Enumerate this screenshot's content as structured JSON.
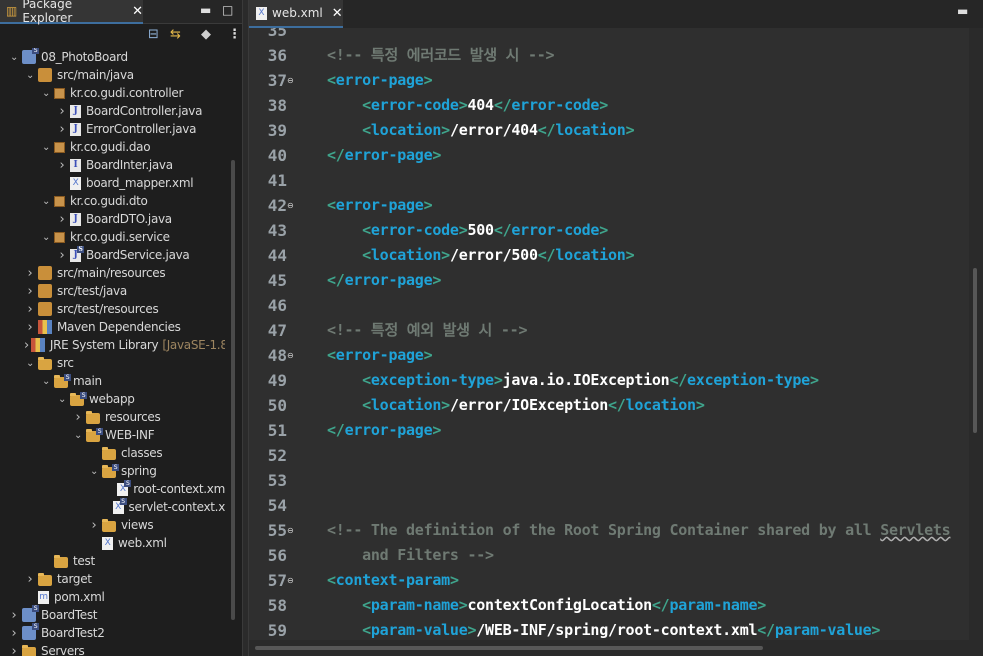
{
  "package_explorer": {
    "title": "Package Explorer",
    "tree": [
      {
        "label": "08_PhotoBoard",
        "level": 0,
        "expanded": true,
        "icon": "project-icon"
      },
      {
        "label": "src/main/java",
        "level": 1,
        "expanded": true,
        "icon": "source-folder-icon"
      },
      {
        "label": "kr.co.gudi.controller",
        "level": 2,
        "expanded": true,
        "icon": "package-icon"
      },
      {
        "label": "BoardController.java",
        "level": 3,
        "expanded": false,
        "icon": "java-file-icon"
      },
      {
        "label": "ErrorController.java",
        "level": 3,
        "expanded": false,
        "icon": "java-file-icon"
      },
      {
        "label": "kr.co.gudi.dao",
        "level": 2,
        "expanded": true,
        "icon": "package-icon"
      },
      {
        "label": "BoardInter.java",
        "level": 3,
        "expanded": false,
        "icon": "interface-file-icon"
      },
      {
        "label": "board_mapper.xml",
        "level": 3,
        "expanded": null,
        "icon": "xml-file-icon"
      },
      {
        "label": "kr.co.gudi.dto",
        "level": 2,
        "expanded": true,
        "icon": "package-icon"
      },
      {
        "label": "BoardDTO.java",
        "level": 3,
        "expanded": false,
        "icon": "java-file-icon"
      },
      {
        "label": "kr.co.gudi.service",
        "level": 2,
        "expanded": true,
        "icon": "package-icon"
      },
      {
        "label": "BoardService.java",
        "level": 3,
        "expanded": false,
        "icon": "spring-java-file-icon"
      },
      {
        "label": "src/main/resources",
        "level": 1,
        "expanded": false,
        "icon": "source-folder-icon"
      },
      {
        "label": "src/test/java",
        "level": 1,
        "expanded": false,
        "icon": "source-folder-icon"
      },
      {
        "label": "src/test/resources",
        "level": 1,
        "expanded": false,
        "icon": "source-folder-icon"
      },
      {
        "label": "Maven Dependencies",
        "level": 1,
        "expanded": false,
        "icon": "library-icon"
      },
      {
        "label": "JRE System Library",
        "suffix": "[JavaSE-1.8",
        "level": 1,
        "expanded": false,
        "icon": "library-icon"
      },
      {
        "label": "src",
        "level": 1,
        "expanded": true,
        "icon": "folder-icon"
      },
      {
        "label": "main",
        "level": 2,
        "expanded": true,
        "icon": "spring-folder-icon"
      },
      {
        "label": "webapp",
        "level": 3,
        "expanded": true,
        "icon": "spring-folder-icon"
      },
      {
        "label": "resources",
        "level": 4,
        "expanded": false,
        "icon": "folder-icon"
      },
      {
        "label": "WEB-INF",
        "level": 4,
        "expanded": true,
        "icon": "spring-folder-icon"
      },
      {
        "label": "classes",
        "level": 5,
        "expanded": null,
        "icon": "folder-icon"
      },
      {
        "label": "spring",
        "level": 5,
        "expanded": true,
        "icon": "spring-folder-icon"
      },
      {
        "label": "root-context.xm",
        "level": 6,
        "expanded": null,
        "icon": "spring-xml-icon"
      },
      {
        "label": "servlet-context.x",
        "level": 6,
        "expanded": null,
        "icon": "spring-xml-icon"
      },
      {
        "label": "views",
        "level": 5,
        "expanded": false,
        "icon": "folder-icon"
      },
      {
        "label": "web.xml",
        "level": 5,
        "expanded": null,
        "icon": "xml-file-icon"
      },
      {
        "label": "test",
        "level": 2,
        "expanded": null,
        "icon": "folder-icon"
      },
      {
        "label": "target",
        "level": 1,
        "expanded": false,
        "icon": "folder-icon"
      },
      {
        "label": "pom.xml",
        "level": 1,
        "expanded": null,
        "icon": "maven-file-icon"
      },
      {
        "label": "BoardTest",
        "level": 0,
        "expanded": false,
        "icon": "project-icon"
      },
      {
        "label": "BoardTest2",
        "level": 0,
        "expanded": false,
        "icon": "project-error-icon"
      },
      {
        "label": "Servers",
        "level": 0,
        "expanded": false,
        "icon": "folder-icon"
      }
    ]
  },
  "editor": {
    "tab_label": "web.xml",
    "lines": [
      {
        "n": "35",
        "fold": false,
        "tokens": []
      },
      {
        "n": "36",
        "fold": false,
        "tokens": [
          {
            "t": "cm",
            "v": "<!-- 특정 에러코드 발생 시 -->"
          }
        ]
      },
      {
        "n": "37",
        "fold": true,
        "tokens": [
          {
            "t": "br",
            "v": "<"
          },
          {
            "t": "tag",
            "v": "error-page"
          },
          {
            "t": "br",
            "v": ">"
          }
        ]
      },
      {
        "n": "38",
        "fold": false,
        "tokens": [
          {
            "t": "txt",
            "v": "    "
          },
          {
            "t": "br",
            "v": "<"
          },
          {
            "t": "tag",
            "v": "error-code"
          },
          {
            "t": "br",
            "v": ">"
          },
          {
            "t": "txt",
            "v": "404"
          },
          {
            "t": "br",
            "v": "</"
          },
          {
            "t": "tag",
            "v": "error-code"
          },
          {
            "t": "br",
            "v": ">"
          }
        ]
      },
      {
        "n": "39",
        "fold": false,
        "tokens": [
          {
            "t": "txt",
            "v": "    "
          },
          {
            "t": "br",
            "v": "<"
          },
          {
            "t": "tag",
            "v": "location"
          },
          {
            "t": "br",
            "v": ">"
          },
          {
            "t": "txt",
            "v": "/error/404"
          },
          {
            "t": "br",
            "v": "</"
          },
          {
            "t": "tag",
            "v": "location"
          },
          {
            "t": "br",
            "v": ">"
          }
        ]
      },
      {
        "n": "40",
        "fold": false,
        "tokens": [
          {
            "t": "br",
            "v": "</"
          },
          {
            "t": "tag",
            "v": "error-page"
          },
          {
            "t": "br",
            "v": ">"
          }
        ]
      },
      {
        "n": "41",
        "fold": false,
        "tokens": []
      },
      {
        "n": "42",
        "fold": true,
        "tokens": [
          {
            "t": "br",
            "v": "<"
          },
          {
            "t": "tag",
            "v": "error-page"
          },
          {
            "t": "br",
            "v": ">"
          }
        ]
      },
      {
        "n": "43",
        "fold": false,
        "tokens": [
          {
            "t": "txt",
            "v": "    "
          },
          {
            "t": "br",
            "v": "<"
          },
          {
            "t": "tag",
            "v": "error-code"
          },
          {
            "t": "br",
            "v": ">"
          },
          {
            "t": "txt",
            "v": "500"
          },
          {
            "t": "br",
            "v": "</"
          },
          {
            "t": "tag",
            "v": "error-code"
          },
          {
            "t": "br",
            "v": ">"
          }
        ]
      },
      {
        "n": "44",
        "fold": false,
        "tokens": [
          {
            "t": "txt",
            "v": "    "
          },
          {
            "t": "br",
            "v": "<"
          },
          {
            "t": "tag",
            "v": "location"
          },
          {
            "t": "br",
            "v": ">"
          },
          {
            "t": "txt",
            "v": "/error/500"
          },
          {
            "t": "br",
            "v": "</"
          },
          {
            "t": "tag",
            "v": "location"
          },
          {
            "t": "br",
            "v": ">"
          }
        ]
      },
      {
        "n": "45",
        "fold": false,
        "tokens": [
          {
            "t": "br",
            "v": "</"
          },
          {
            "t": "tag",
            "v": "error-page"
          },
          {
            "t": "br",
            "v": ">"
          }
        ]
      },
      {
        "n": "46",
        "fold": false,
        "tokens": []
      },
      {
        "n": "47",
        "fold": false,
        "tokens": [
          {
            "t": "cm",
            "v": "<!-- 특정 예외 발생 시 -->"
          }
        ]
      },
      {
        "n": "48",
        "fold": true,
        "tokens": [
          {
            "t": "br",
            "v": "<"
          },
          {
            "t": "tag",
            "v": "error-page"
          },
          {
            "t": "br",
            "v": ">"
          }
        ]
      },
      {
        "n": "49",
        "fold": false,
        "tokens": [
          {
            "t": "txt",
            "v": "    "
          },
          {
            "t": "br",
            "v": "<"
          },
          {
            "t": "tag",
            "v": "exception-type"
          },
          {
            "t": "br",
            "v": ">"
          },
          {
            "t": "txt",
            "v": "java.io.IOException"
          },
          {
            "t": "br",
            "v": "</"
          },
          {
            "t": "tag",
            "v": "exception-type"
          },
          {
            "t": "br",
            "v": ">"
          }
        ]
      },
      {
        "n": "50",
        "fold": false,
        "tokens": [
          {
            "t": "txt",
            "v": "    "
          },
          {
            "t": "br",
            "v": "<"
          },
          {
            "t": "tag",
            "v": "location"
          },
          {
            "t": "br",
            "v": ">"
          },
          {
            "t": "txt",
            "v": "/error/IOException"
          },
          {
            "t": "br",
            "v": "</"
          },
          {
            "t": "tag",
            "v": "location"
          },
          {
            "t": "br",
            "v": ">"
          }
        ]
      },
      {
        "n": "51",
        "fold": false,
        "tokens": [
          {
            "t": "br",
            "v": "</"
          },
          {
            "t": "tag",
            "v": "error-page"
          },
          {
            "t": "br",
            "v": ">"
          }
        ]
      },
      {
        "n": "52",
        "fold": false,
        "tokens": []
      },
      {
        "n": "53",
        "fold": false,
        "tokens": []
      },
      {
        "n": "54",
        "fold": false,
        "tokens": []
      },
      {
        "n": "55",
        "fold": true,
        "tokens": [
          {
            "t": "cm",
            "v": "<!-- The definition of the Root Spring Container shared by all "
          },
          {
            "t": "cmsq",
            "v": "Servlets"
          }
        ]
      },
      {
        "n": "56",
        "fold": false,
        "tokens": [
          {
            "t": "cm",
            "v": "    and Filters -->"
          }
        ]
      },
      {
        "n": "57",
        "fold": true,
        "tokens": [
          {
            "t": "br",
            "v": "<"
          },
          {
            "t": "tag",
            "v": "context-param"
          },
          {
            "t": "br",
            "v": ">"
          }
        ]
      },
      {
        "n": "58",
        "fold": false,
        "tokens": [
          {
            "t": "txt",
            "v": "    "
          },
          {
            "t": "br",
            "v": "<"
          },
          {
            "t": "tag",
            "v": "param-name"
          },
          {
            "t": "br",
            "v": ">"
          },
          {
            "t": "txt",
            "v": "contextConfigLocation"
          },
          {
            "t": "br",
            "v": "</"
          },
          {
            "t": "tag",
            "v": "param-name"
          },
          {
            "t": "br",
            "v": ">"
          }
        ]
      },
      {
        "n": "59",
        "fold": false,
        "tokens": [
          {
            "t": "txt",
            "v": "    "
          },
          {
            "t": "br",
            "v": "<"
          },
          {
            "t": "tag",
            "v": "param-value"
          },
          {
            "t": "br",
            "v": ">"
          },
          {
            "t": "txt",
            "v": "/WEB-INF/spring/root-context.xml"
          },
          {
            "t": "br",
            "v": "</"
          },
          {
            "t": "tag",
            "v": "param-value"
          },
          {
            "t": "br",
            "v": ">"
          }
        ]
      }
    ]
  },
  "colors": {
    "tag": "#1fa3d8",
    "bracket": "#3fa48c",
    "comment": "#6f7a73",
    "text": "#ffffff",
    "active_tab_accent": "#3d6e9e"
  }
}
